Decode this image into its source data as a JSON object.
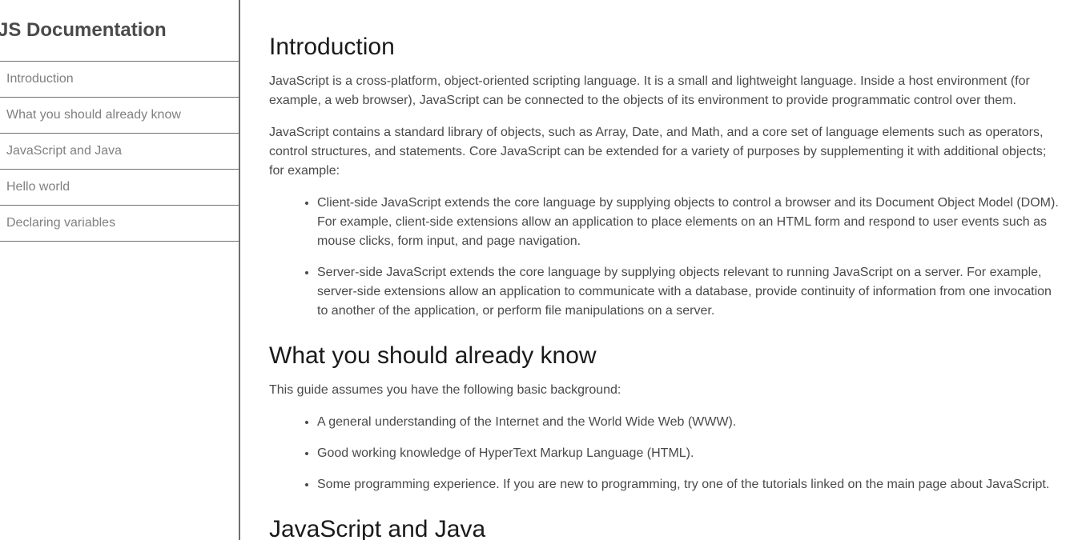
{
  "navbar": {
    "title": "JS Documentation",
    "items": [
      {
        "label": "Introduction"
      },
      {
        "label": "What you should already know"
      },
      {
        "label": "JavaScript and Java"
      },
      {
        "label": "Hello world"
      },
      {
        "label": "Declaring variables"
      }
    ]
  },
  "main": {
    "introduction": {
      "heading": "Introduction",
      "p1": "JavaScript is a cross-platform, object-oriented scripting language. It is a small and lightweight language. Inside a host environment (for example, a web browser), JavaScript can be connected to the objects of its environment to provide programmatic control over them.",
      "p2": "JavaScript contains a standard library of objects, such as Array, Date, and Math, and a core set of language elements such as operators, control structures, and statements. Core JavaScript can be extended for a variety of purposes by supplementing it with additional objects; for example:",
      "bullets": [
        "Client-side JavaScript extends the core language by supplying objects to control a browser and its Document Object Model (DOM). For example, client-side extensions allow an application to place elements on an HTML form and respond to user events such as mouse clicks, form input, and page navigation.",
        "Server-side JavaScript extends the core language by supplying objects relevant to running JavaScript on a server. For example, server-side extensions allow an application to communicate with a database, provide continuity of information from one invocation to another of the application, or perform file manipulations on a server."
      ]
    },
    "already_know": {
      "heading": "What you should already know",
      "p1": "This guide assumes you have the following basic background:",
      "bullets": [
        "A general understanding of the Internet and the World Wide Web (WWW).",
        "Good working knowledge of HyperText Markup Language (HTML).",
        "Some programming experience. If you are new to programming, try one of the tutorials linked on the main page about JavaScript."
      ]
    },
    "javascript_and_java": {
      "heading": "JavaScript and Java"
    }
  }
}
